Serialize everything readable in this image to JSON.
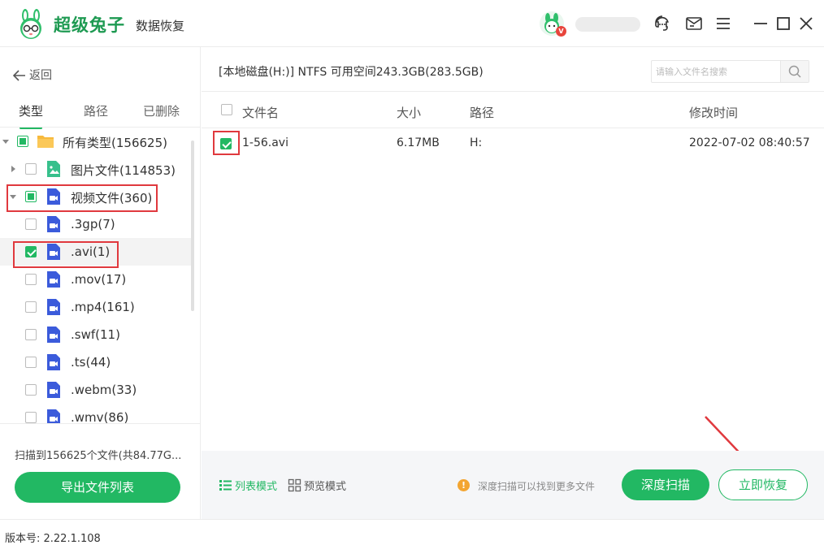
{
  "app": {
    "title": "超级兔子",
    "subtitle": "数据恢复",
    "vip_badge": "V"
  },
  "colors": {
    "accent": "#22b863",
    "highlight": "#e0393e",
    "tip": "#f3a531"
  },
  "sidebar": {
    "back_label": "返回",
    "tabs": [
      {
        "label": "类型",
        "active": true
      },
      {
        "label": "路径",
        "active": false
      },
      {
        "label": "已删除",
        "active": false
      }
    ],
    "tree": [
      {
        "label": "所有类型(156625)",
        "icon": "folder-icon",
        "check": "partial",
        "expand": "expanded"
      },
      {
        "label": "图片文件(114853)",
        "icon": "image-file-icon",
        "check": "unchecked",
        "expand": "collapsed"
      },
      {
        "label": "视频文件(360)",
        "icon": "video-file-icon",
        "check": "partial",
        "expand": "expanded"
      },
      {
        "label": ".3gp(7)",
        "icon": "video-file-icon",
        "check": "unchecked"
      },
      {
        "label": ".avi(1)",
        "icon": "video-file-icon",
        "check": "checked",
        "selected": true
      },
      {
        "label": ".mov(17)",
        "icon": "video-file-icon",
        "check": "unchecked"
      },
      {
        "label": ".mp4(161)",
        "icon": "video-file-icon",
        "check": "unchecked"
      },
      {
        "label": ".swf(11)",
        "icon": "video-file-icon",
        "check": "unchecked"
      },
      {
        "label": ".ts(44)",
        "icon": "video-file-icon",
        "check": "unchecked"
      },
      {
        "label": ".webm(33)",
        "icon": "video-file-icon",
        "check": "unchecked"
      },
      {
        "label": ".wmv(86)",
        "icon": "video-file-icon",
        "check": "unchecked"
      }
    ],
    "scan_summary": "扫描到156625个文件(共84.77G...",
    "export_label": "导出文件列表"
  },
  "main": {
    "drive_info": "[本地磁盘(H:)] NTFS 可用空间243.3GB(283.5GB)",
    "search_placeholder": "请输入文件名搜索",
    "columns": {
      "name": "文件名",
      "size": "大小",
      "path": "路径",
      "modified": "修改时间"
    },
    "files": [
      {
        "name": "1-56.avi",
        "size": "6.17MB",
        "path": "H:",
        "modified": "2022-07-02 08:40:57",
        "checked": true
      }
    ],
    "list_mode_label": "列表模式",
    "preview_mode_label": "预览模式",
    "tip_icon": "!",
    "tip": "深度扫描可以找到更多文件",
    "deep_scan_label": "深度扫描",
    "recover_label": "立即恢复"
  },
  "status": {
    "version": "版本号: 2.22.1.108"
  }
}
